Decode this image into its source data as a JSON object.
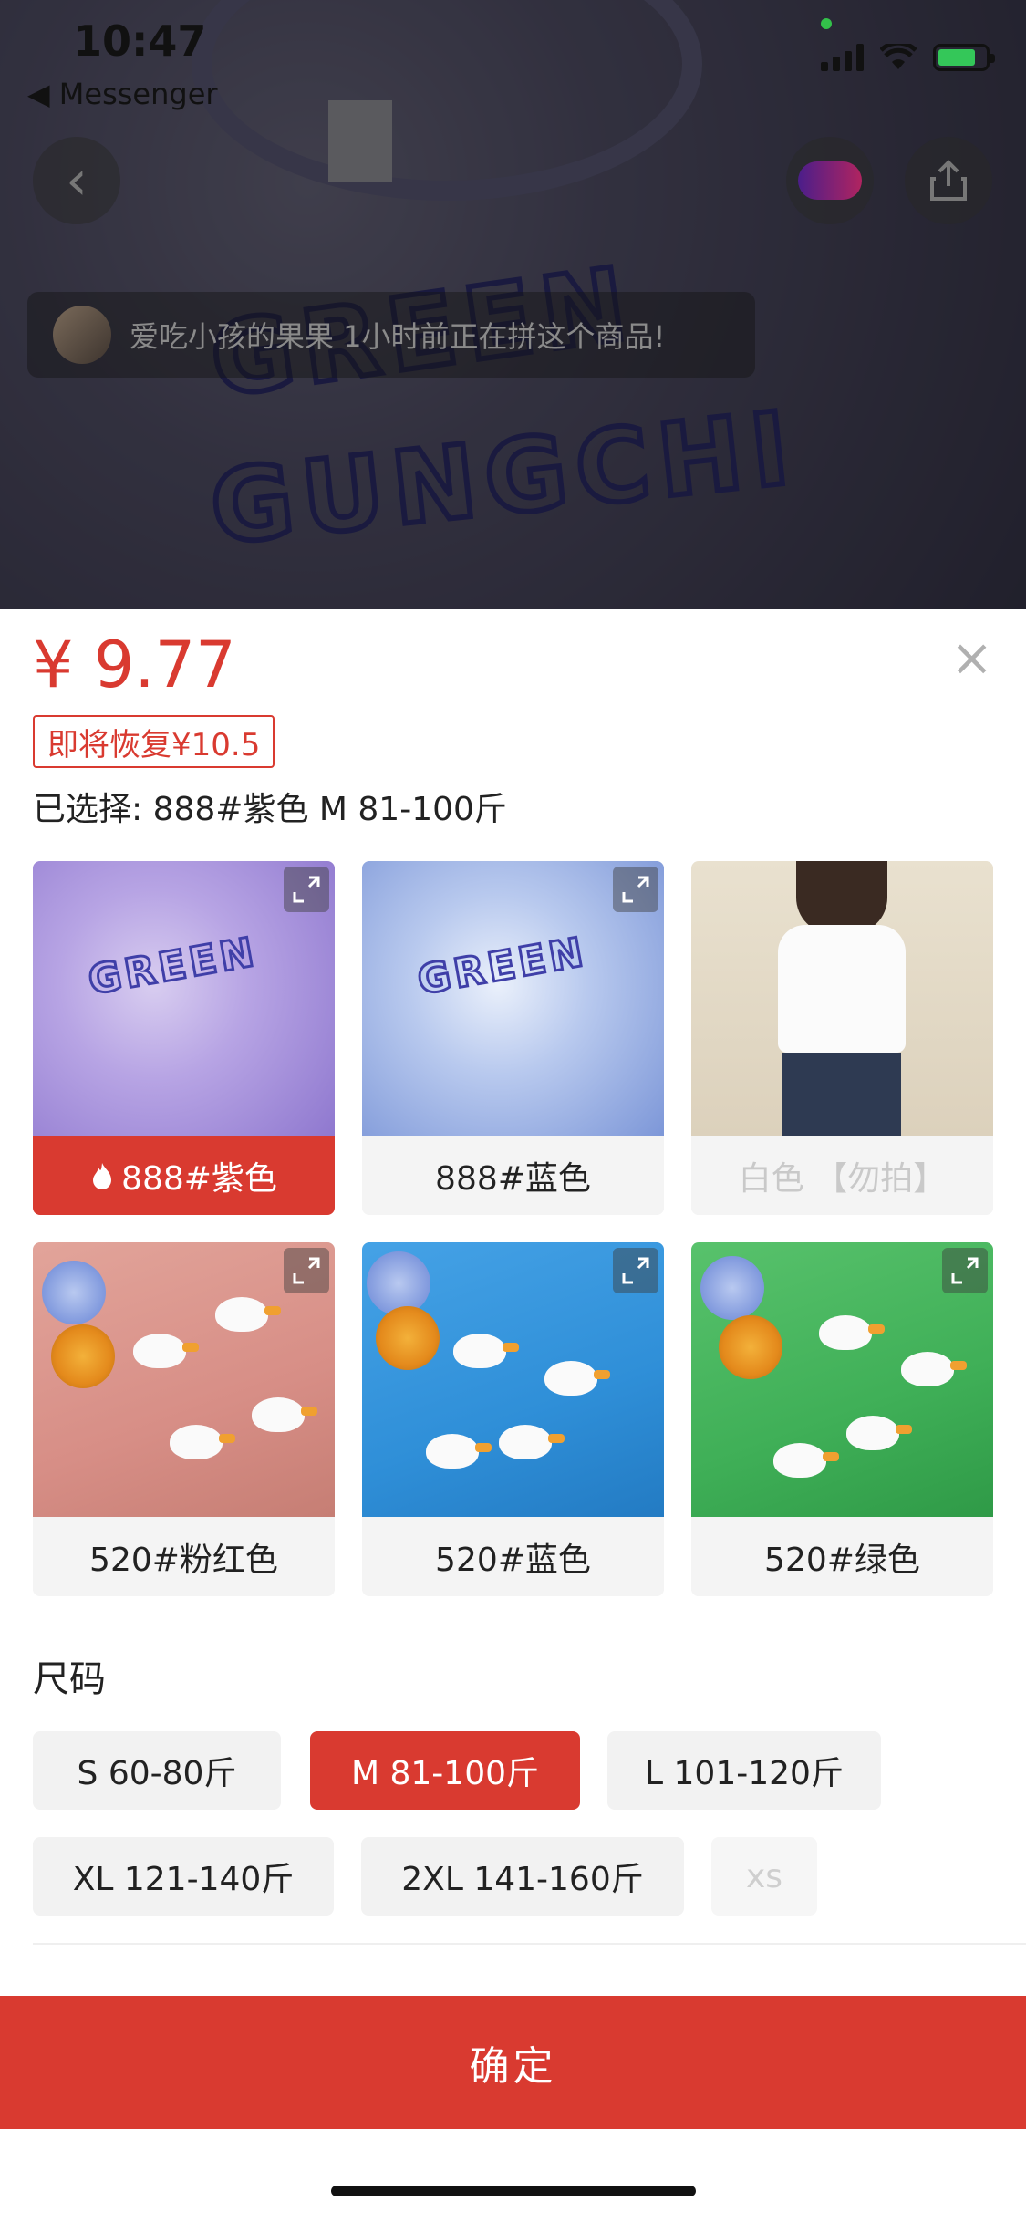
{
  "status_bar": {
    "time": "10:47",
    "back_app": "◀ Messenger"
  },
  "group_banner": {
    "text": "爱吃小孩的果果 1小时前正在拼这个商品!"
  },
  "sheet": {
    "price": "¥ 9.77",
    "restore_tag": "即将恢复¥10.5",
    "selected": "已选择: 888#紫色 M 81-100斤",
    "close": "×"
  },
  "variants": [
    {
      "label": "888#紫色",
      "state": "selected",
      "icon": "fire-icon"
    },
    {
      "label": "888#蓝色",
      "state": "normal"
    },
    {
      "label": "白色 【勿拍】",
      "state": "disabled"
    },
    {
      "label": "520#粉红色",
      "state": "normal"
    },
    {
      "label": "520#蓝色",
      "state": "normal"
    },
    {
      "label": "520#绿色",
      "state": "normal"
    }
  ],
  "size": {
    "title": "尺码",
    "options": [
      {
        "label": "S 60-80斤",
        "state": "normal"
      },
      {
        "label": "M 81-100斤",
        "state": "selected"
      },
      {
        "label": "L 101-120斤",
        "state": "normal"
      },
      {
        "label": "XL 121-140斤",
        "state": "normal"
      },
      {
        "label": "2XL 141-160斤",
        "state": "normal"
      },
      {
        "label": "xs",
        "state": "disabled"
      }
    ]
  },
  "confirm_button": "确定",
  "colors": {
    "accent": "#d93a30",
    "chip_bg": "#f2f2f2"
  }
}
